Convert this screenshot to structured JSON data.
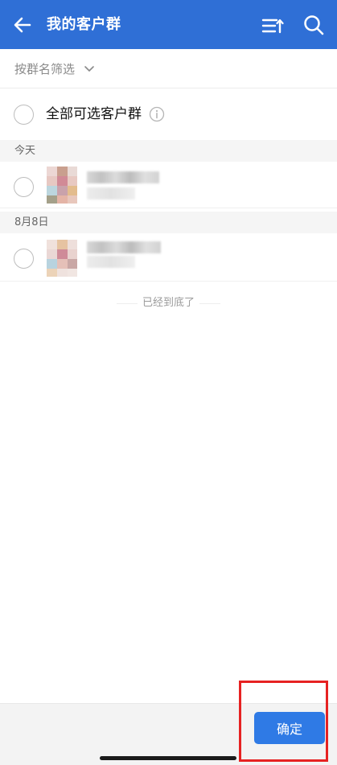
{
  "header": {
    "title": "我的客户群",
    "back_icon": "arrow-left-icon",
    "sort_icon": "sort-list-icon",
    "search_icon": "search-icon",
    "background_color": "#2f6fd6"
  },
  "filter": {
    "label": "按群名筛选",
    "icon": "chevron-down-icon"
  },
  "select_all": {
    "label": "全部可选客户群",
    "info_icon": "info-circle-icon",
    "checked": false
  },
  "sections": [
    {
      "header": "今天",
      "groups": [
        {
          "name": "",
          "checked": false
        }
      ]
    },
    {
      "header": "8月8日",
      "groups": [
        {
          "name": "",
          "checked": false
        }
      ]
    }
  ],
  "end_text": "已经到底了",
  "footer": {
    "confirm_label": "确定",
    "accent_color": "#2f7ae5",
    "highlight_color": "#e62222"
  }
}
